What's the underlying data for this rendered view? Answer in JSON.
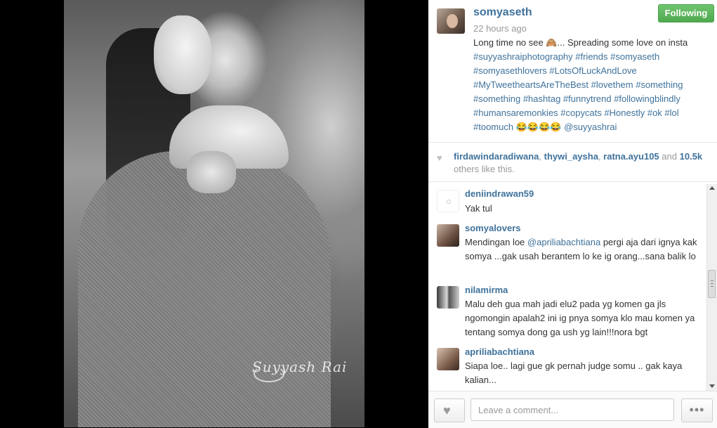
{
  "post": {
    "username": "somyaseth",
    "timestamp": "22 hours ago",
    "follow_label": "Following",
    "caption_plain": "Long time no see 🙈... Spreading some love on insta",
    "hashtags": "#suyyashraiphotography #friends #somyaseth #somyasethlovers #LotsOfLuckAndLove #MyTweetheartsAreTheBest #lovethem #something #something #hashtag #funnytrend #followingblindly #humansaremonkies #copycats #Honestly #ok #lol #toomuch",
    "caption_tail": "😂😂😂😂",
    "mention": "@suyyashrai",
    "watermark": "Suyyash Rai"
  },
  "likes": {
    "user1": "firdawindaradiwana",
    "user2": "thywi_aysha",
    "user3": "ratna.ayu105",
    "and": "and",
    "count": "10.5k",
    "suffix": "others like this."
  },
  "comments": [
    {
      "user": "deniindrawan59",
      "text": "Yak tul"
    },
    {
      "user": "somyalovers",
      "mention": "@apriliabachtiana",
      "prefix": "Mendingan loe",
      "text": "pergi aja dari ignya kak somya ...gak usah berantem lo ke ig orang...sana balik lo"
    },
    {
      "user": "nilamirma",
      "text": "Malu deh gua mah jadi elu2 pada yg komen ga jls ngomongin apalah2 ini ig pnya somya klo mau komen ya tentang somya dong ga ush yg lain!!!nora bgt"
    },
    {
      "user": "apriliabachtiana",
      "text": "Siapa loe.. lagi gue gk pernah judge somu .. gak kaya kalian..."
    }
  ],
  "footer": {
    "comment_placeholder": "Leave a comment...",
    "more_label": "•••"
  },
  "colors": {
    "link": "#3f729b",
    "follow_green": "#5cb85c"
  }
}
